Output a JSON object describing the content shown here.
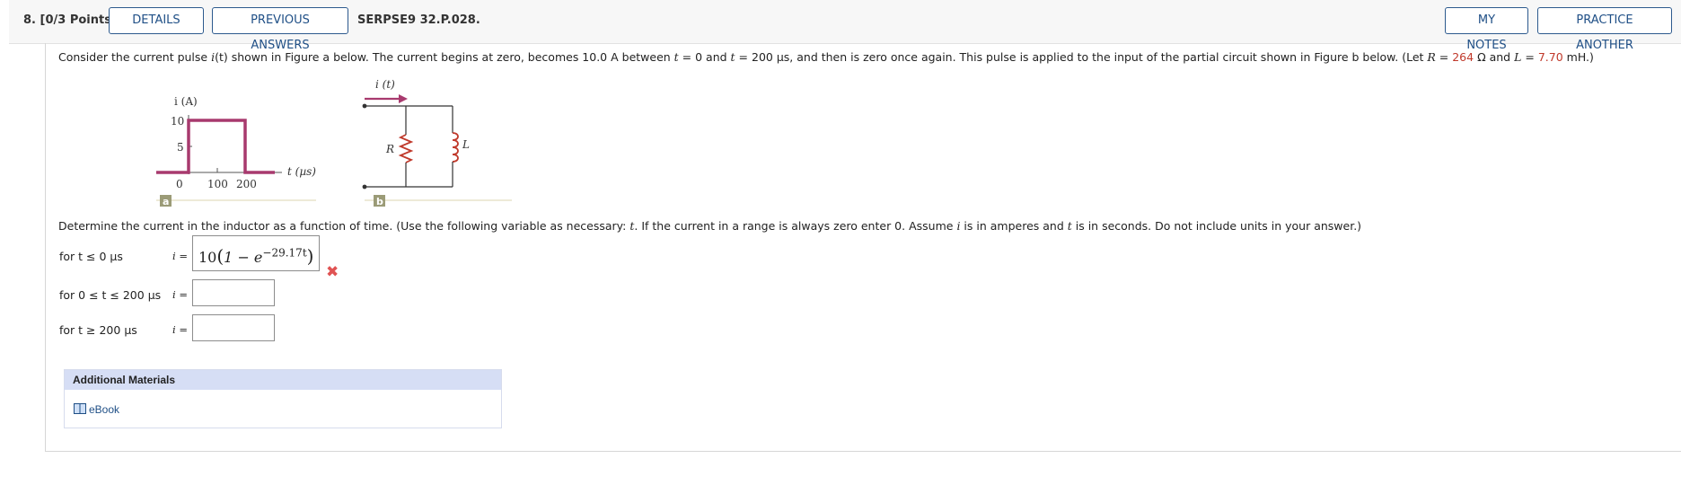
{
  "header": {
    "question_number": "8.",
    "points": "[0/3 Points]",
    "details_label": "DETAILS",
    "previous_answers_label": "PREVIOUS ANSWERS",
    "problem_code": "SERPSE9 32.P.028.",
    "my_notes_label": "MY NOTES",
    "practice_another_label": "PRACTICE ANOTHER"
  },
  "problem": {
    "p1": "Consider the current pulse ",
    "p2": "i",
    "p3": "(t) shown in Figure a below. The current begins at zero, becomes 10.0 A between ",
    "p4": "t",
    "p5": " = 0 and ",
    "p6": "t",
    "p7": " = 200 µs, and then is zero once again. This pulse is applied to the input of the partial circuit shown in Figure b below. (Let ",
    "p8": "R",
    "p9": " = ",
    "R_value": "264",
    "p10": " Ω and ",
    "p11": "L",
    "p12": " = ",
    "L_value": "7.70",
    "p13": " mH.)"
  },
  "figure_a": {
    "ylabel": "i (A)",
    "ytick_10": "10",
    "ytick_5": "5",
    "xtick_0": "0",
    "xtick_100": "100",
    "xtick_200": "200",
    "xlabel": "t (µs)",
    "tag": "a"
  },
  "figure_b": {
    "current_label": "i (t)",
    "R_label": "R",
    "L_label": "L",
    "tag": "b"
  },
  "instructions": {
    "t1": "Determine the current in the inductor as a function of time. (Use the following variable as necessary: ",
    "t2": "t",
    "t3": ". If the current in a range is always zero enter 0. Assume ",
    "t4": "i",
    "t5": " is in amperes and ",
    "t6": "t",
    "t7": " is in seconds. Do not include units in your answer.)"
  },
  "answers": [
    {
      "range": "for t ≤ 0 µs",
      "i_label": "i =",
      "value_prefix": "10",
      "value_inner": "1 − e",
      "value_exp": "−29.17t",
      "status": "incorrect"
    },
    {
      "range": "for 0 ≤ t ≤ 200 µs",
      "i_label": "i =",
      "value": ""
    },
    {
      "range": "for t ≥ 200 µs",
      "i_label": "i =",
      "value": ""
    }
  ],
  "additional_materials": {
    "title": "Additional Materials",
    "ebook_label": "eBook"
  },
  "colors": {
    "accent_blue": "#1f4f86",
    "value_red": "#c0392b",
    "pulse_magenta": "#a83a6e",
    "incorrect_x": "#e05353"
  }
}
